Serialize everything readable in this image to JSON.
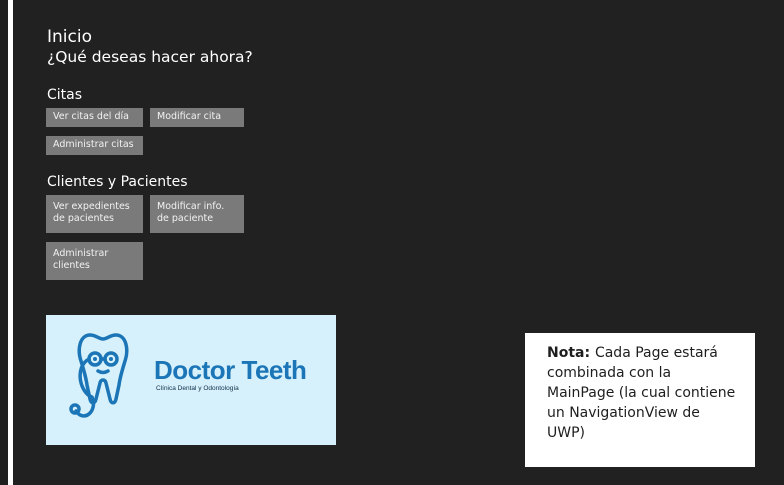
{
  "header": {
    "title": "Inicio",
    "subtitle": "¿Qué deseas hacer ahora?"
  },
  "sections": {
    "citas": {
      "title": "Citas",
      "buttons": {
        "ver_citas": "Ver citas del día",
        "modificar_cita": "Modificar cita",
        "administrar_citas": "Administrar citas"
      }
    },
    "clientes": {
      "title": "Clientes y Pacientes",
      "buttons": {
        "ver_expedientes_1": "Ver expedientes",
        "ver_expedientes_2": "de pacientes",
        "modificar_info_1": "Modificar info.",
        "modificar_info_2": "de paciente",
        "administrar_clientes_1": "Administrar",
        "administrar_clientes_2": "clientes"
      }
    }
  },
  "logo": {
    "brand": "Doctor Teeth",
    "tagline": "Clínica Dental y Odontología",
    "color": "#1b75b6"
  },
  "note": {
    "label": "Nota:",
    "text": "Cada Page estará combinada con la MainPage (la cual contiene un NavigationView de UWP)"
  },
  "colors": {
    "background": "#212121",
    "button": "#7a7a7a",
    "logo_bg": "#d6f1fb"
  }
}
